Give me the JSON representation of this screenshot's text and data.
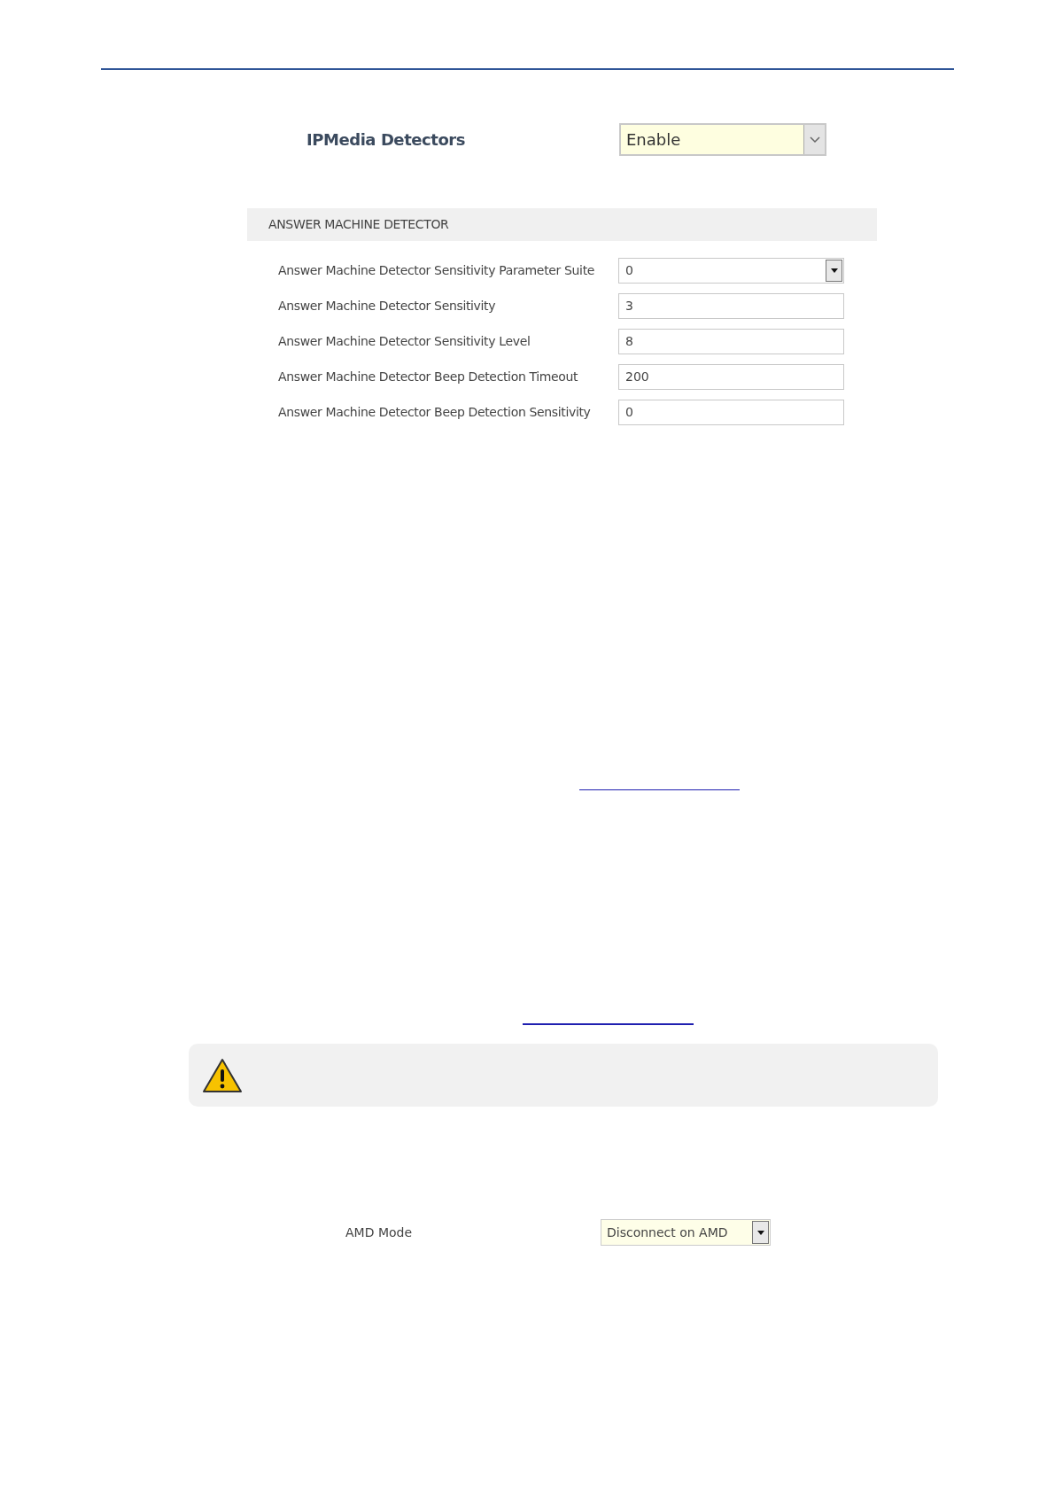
{
  "detectors": {
    "label": "IPMedia Detectors",
    "value": "Enable"
  },
  "section": {
    "title": "ANSWER MACHINE DETECTOR",
    "rows": [
      {
        "kind": "dropdown",
        "label": "Answer Machine Detector Sensitivity Parameter Suite",
        "value": "0"
      },
      {
        "kind": "text",
        "label": "Answer Machine Detector Sensitivity",
        "value": "3"
      },
      {
        "kind": "text",
        "label": "Answer Machine Detector Sensitivity Level",
        "value": "8"
      },
      {
        "kind": "text",
        "label": "Answer Machine Detector Beep Detection Timeout",
        "value": "200"
      },
      {
        "kind": "text",
        "label": "Answer Machine Detector Beep Detection Sensitivity",
        "value": "0"
      }
    ]
  },
  "amd": {
    "label": "AMD Mode",
    "value": "Disconnect on AMD"
  }
}
